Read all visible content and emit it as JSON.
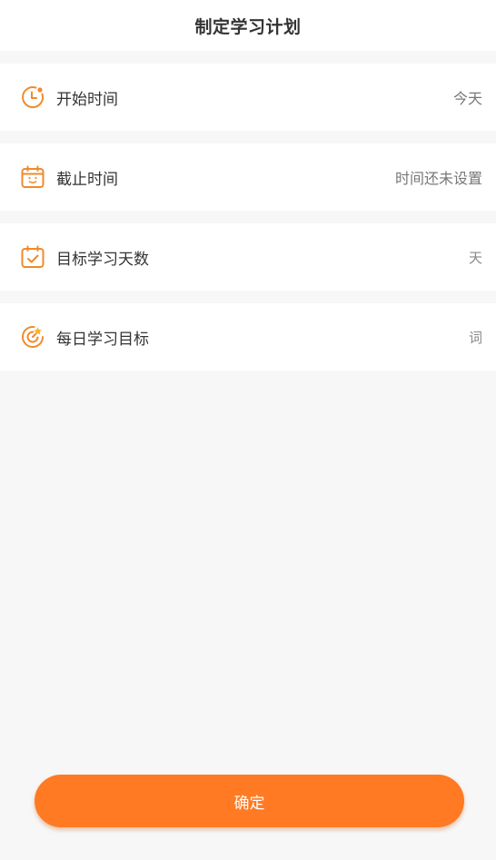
{
  "header": {
    "title": "制定学习计划"
  },
  "rows": [
    {
      "icon": "clock-icon",
      "label": "开始时间",
      "value": "今天"
    },
    {
      "icon": "calendar-icon",
      "label": "截止时间",
      "value": "时间还未设置"
    },
    {
      "icon": "calendar-check-icon",
      "label": "目标学习天数",
      "value": "天"
    },
    {
      "icon": "target-icon",
      "label": "每日学习目标",
      "value": "词"
    }
  ],
  "confirm": {
    "label": "确定"
  },
  "colors": {
    "accent": "#ff7a22",
    "icon": "#f08a2c",
    "background": "#f7f7f7"
  }
}
